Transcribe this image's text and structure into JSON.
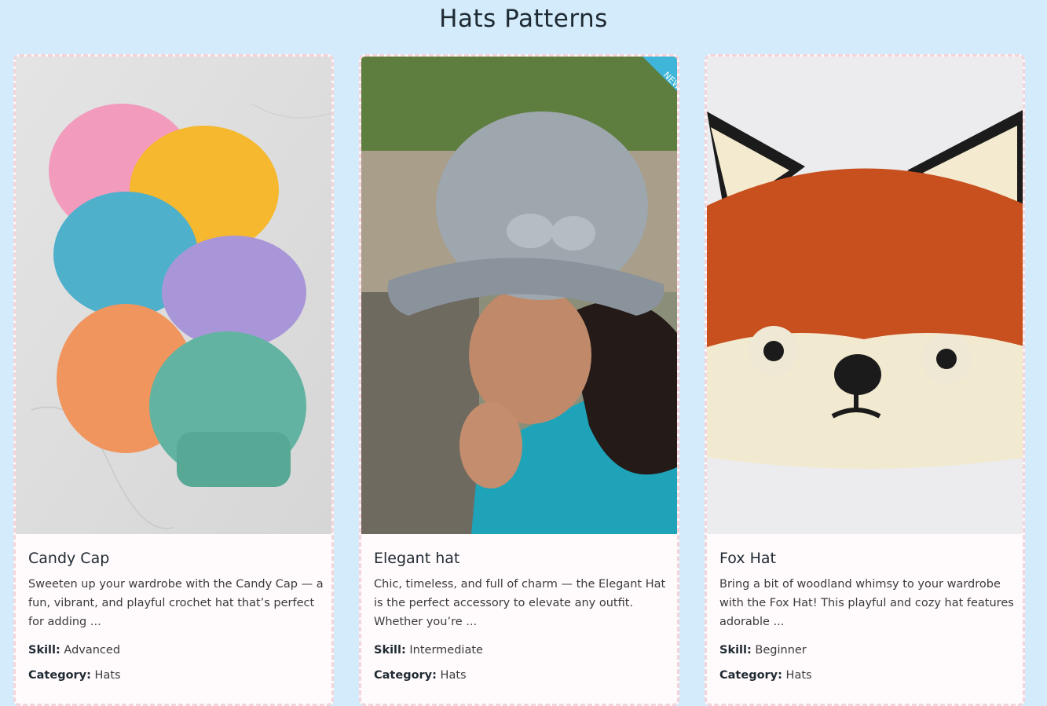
{
  "page": {
    "title": "Hats Patterns",
    "background": "#d3ebfa"
  },
  "cards": [
    {
      "title": "Candy Cap",
      "description": "Sweeten up your wardrobe with the Candy Cap — a fun, vibrant, and playful crochet hat that’s perfect for adding ...",
      "skill_label": "Skill:",
      "skill": "Advanced",
      "category_label": "Category:",
      "category": "Hats",
      "image": "six-pastel-beanies-photo"
    },
    {
      "title": "Elegant hat",
      "description": "Chic, timeless, and full of charm — the Elegant Hat is the perfect accessory to elevate any outfit. Whether you’re ...",
      "skill_label": "Skill:",
      "skill": "Intermediate",
      "category_label": "Category:",
      "category": "Hats",
      "image": "woman-grey-cloche-hat-photo",
      "ribbon": "NEW"
    },
    {
      "title": "Fox Hat",
      "description": "Bring a bit of woodland whimsy to your wardrobe with the Fox Hat! This playful and cozy hat features adorable ...",
      "skill_label": "Skill:",
      "skill": "Beginner",
      "category_label": "Category:",
      "category": "Hats",
      "image": "orange-fox-hat-photo"
    }
  ],
  "colors": {
    "card_border": "#f3d4da",
    "ribbon": "#3fb6d9"
  }
}
